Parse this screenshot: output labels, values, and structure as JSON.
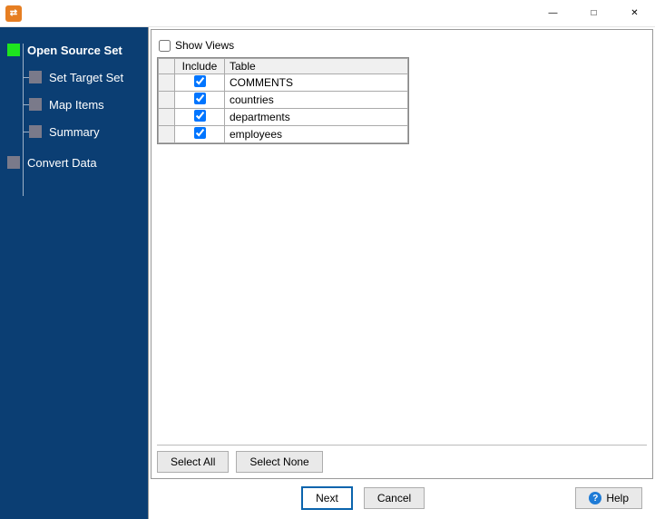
{
  "titlebar": {
    "app_icon": "⇄"
  },
  "sidebar": {
    "items": [
      {
        "label": "Open Source Set",
        "level": 0,
        "active": true
      },
      {
        "label": "Set Target Set",
        "level": 1,
        "active": false
      },
      {
        "label": "Map Items",
        "level": 1,
        "active": false
      },
      {
        "label": "Summary",
        "level": 1,
        "active": false
      },
      {
        "label": "Convert Data",
        "level": 0,
        "active": false
      }
    ]
  },
  "main": {
    "show_views_label": "Show Views",
    "show_views_checked": false,
    "columns": {
      "col1": "Include",
      "col2": "Table"
    },
    "rows": [
      {
        "include": true,
        "table": "COMMENTS"
      },
      {
        "include": true,
        "table": "countries"
      },
      {
        "include": true,
        "table": "departments"
      },
      {
        "include": true,
        "table": "employees"
      }
    ],
    "select_all": "Select All",
    "select_none": "Select None"
  },
  "footer": {
    "next": "Next",
    "cancel": "Cancel",
    "help": "Help"
  }
}
